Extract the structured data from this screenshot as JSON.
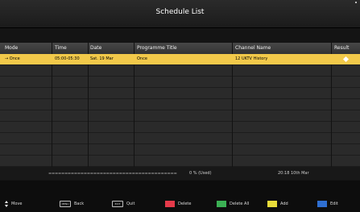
{
  "title": "Schedule List",
  "columns": {
    "mode": "Mode",
    "time": "Time",
    "date": "Date",
    "programme": "Programme Title",
    "channel": "Channel Name",
    "result": "Result"
  },
  "rows": [
    {
      "mode": "→ Once",
      "time": "05:00-05:30",
      "date": "Sat. 19 Mar",
      "programme": "Once",
      "channel": "12 UKTV History",
      "result": "",
      "selected": true
    }
  ],
  "status": {
    "progress_dashes": "========================================",
    "usage": "0 %  (Used)",
    "clock": "20:18 10th Mar"
  },
  "footer": {
    "move": "Move",
    "back_key": "MENU",
    "back": "Back",
    "quit_key": "EXIT",
    "quit": "Quit",
    "delete": "Delete",
    "delete_all": "Delete All",
    "add": "Add",
    "edit": "Edit"
  },
  "colors": {
    "selected_row": "#f2c94a",
    "red": "#e53a4a",
    "green": "#3bb054",
    "yellow": "#e8dc3a",
    "blue": "#2f6fd1"
  }
}
